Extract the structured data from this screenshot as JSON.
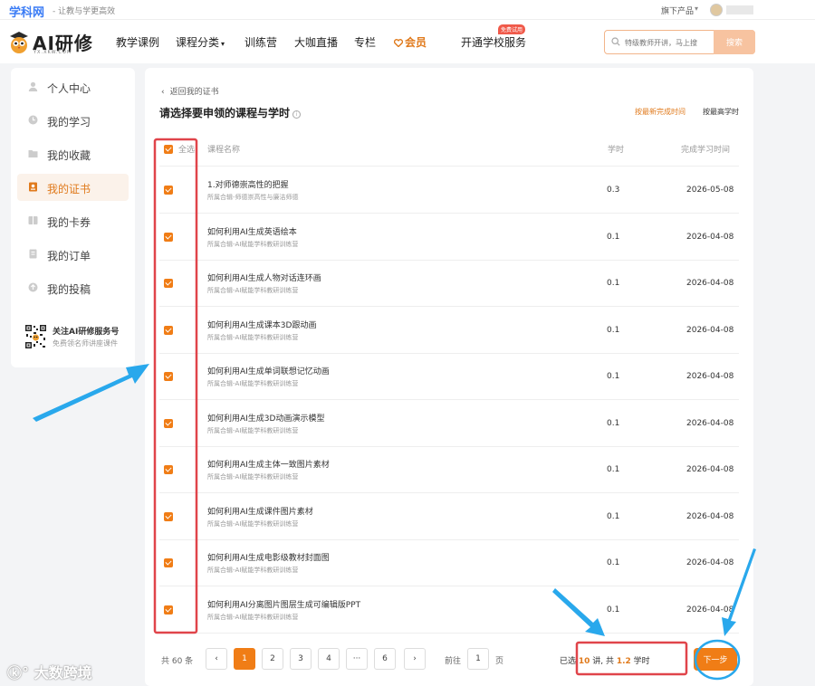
{
  "topbar": {
    "brand": "学科网",
    "slogan": "- 让教与学更高效",
    "download": "旗下产品"
  },
  "nav": {
    "logo_text": "AI研修",
    "logo_sub": "YX.XKW.COM",
    "items": [
      "教学课例",
      "课程分类",
      "训练营",
      "大咖直播",
      "专栏",
      "会员",
      "开通学校服务"
    ],
    "hot_badge": "免费试用",
    "search_placeholder": "特级教师开讲，马上搜",
    "search_button": "搜索"
  },
  "sidebar": {
    "items": [
      {
        "label": "个人中心",
        "icon": "user-icon"
      },
      {
        "label": "我的学习",
        "icon": "clock-icon"
      },
      {
        "label": "我的收藏",
        "icon": "folder-icon"
      },
      {
        "label": "我的证书",
        "icon": "certificate-icon",
        "active": true
      },
      {
        "label": "我的卡券",
        "icon": "coupon-icon"
      },
      {
        "label": "我的订单",
        "icon": "order-icon"
      },
      {
        "label": "我的投稿",
        "icon": "submit-icon"
      }
    ],
    "qr_title": "关注AI研修服务号",
    "qr_sub": "免费领名师讲座课件"
  },
  "main": {
    "back": "返回我的证书",
    "title": "请选择要申领的课程与学时",
    "sort_newest": "按最新完成时间",
    "sort_hours": "按最高学时",
    "headers": {
      "select_all": "全选",
      "name": "课程名称",
      "hours": "学时",
      "date": "完成学习时间"
    },
    "rows": [
      {
        "name": "1.对师德崇高性的把握",
        "sub": "所属合辑-师德崇高性与廉洁师德",
        "hours": "0.3",
        "date": "2026-05-08"
      },
      {
        "name": "如何利用AI生成英语绘本",
        "sub": "所属合辑-AI赋能学科教研训练营",
        "hours": "0.1",
        "date": "2026-04-08"
      },
      {
        "name": "如何利用AI生成人物对话连环画",
        "sub": "所属合辑-AI赋能学科教研训练营",
        "hours": "0.1",
        "date": "2026-04-08"
      },
      {
        "name": "如何利用AI生成课本3D跟动画",
        "sub": "所属合辑-AI赋能学科教研训练营",
        "hours": "0.1",
        "date": "2026-04-08"
      },
      {
        "name": "如何利用AI生成单词联想记忆动画",
        "sub": "所属合辑-AI赋能学科教研训练营",
        "hours": "0.1",
        "date": "2026-04-08"
      },
      {
        "name": "如何利用AI生成3D动画演示模型",
        "sub": "所属合辑-AI赋能学科教研训练营",
        "hours": "0.1",
        "date": "2026-04-08"
      },
      {
        "name": "如何利用AI生成主体一致图片素材",
        "sub": "所属合辑-AI赋能学科教研训练营",
        "hours": "0.1",
        "date": "2026-04-08"
      },
      {
        "name": "如何利用AI生成课件图片素材",
        "sub": "所属合辑-AI赋能学科教研训练营",
        "hours": "0.1",
        "date": "2026-04-08"
      },
      {
        "name": "如何利用AI生成电影级教材封面图",
        "sub": "所属合辑-AI赋能学科教研训练营",
        "hours": "0.1",
        "date": "2026-04-08"
      },
      {
        "name": "如何利用AI分离图片图层生成可编辑版PPT",
        "sub": "所属合辑-AI赋能学科教研训练营",
        "hours": "0.1",
        "date": "2026-04-08"
      }
    ],
    "pagination": {
      "total": "共 60 条",
      "prev": "‹",
      "pages": [
        "1",
        "2",
        "3",
        "4",
        "···",
        "6"
      ],
      "next": "›",
      "goto_label": "前往",
      "goto_value": "1",
      "goto_unit": "页"
    },
    "summary": {
      "prefix": "已选 ",
      "count": "10",
      "mid": " 讲, 共 ",
      "hours": "1.2",
      "suffix": " 学时"
    },
    "next_button": "下一步"
  },
  "colors": {
    "accent": "#f07d16",
    "annotation_red": "#e0444a",
    "annotation_blue": "#29a8ec"
  },
  "watermark": "大数跨境"
}
